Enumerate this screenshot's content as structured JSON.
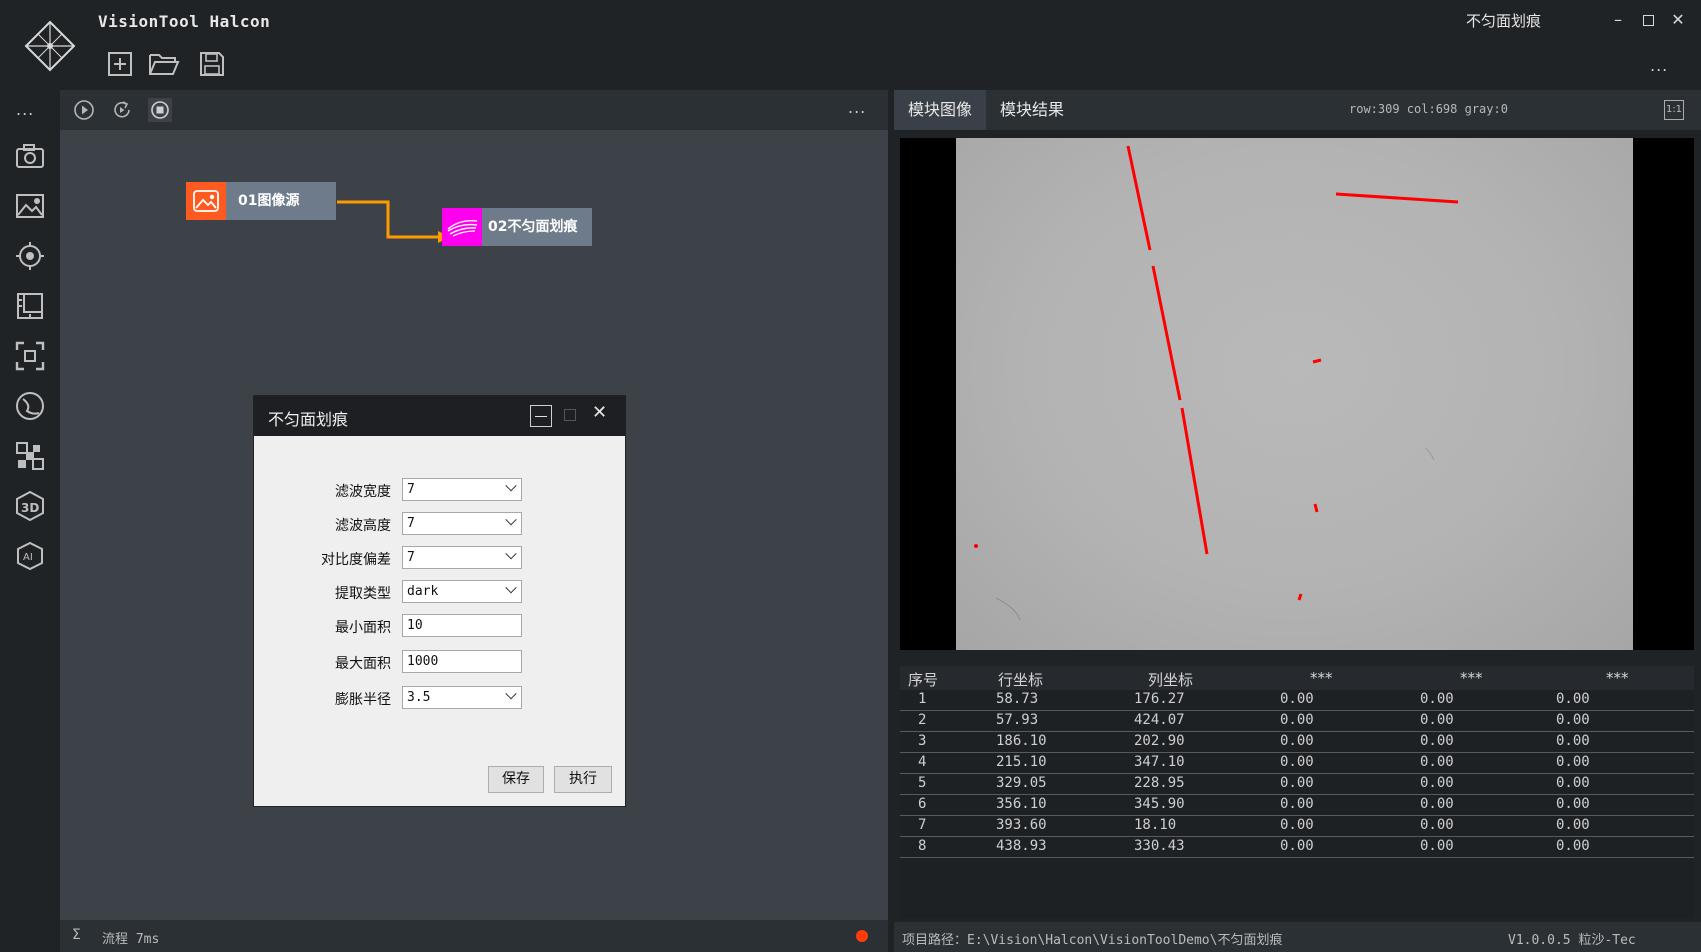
{
  "app": {
    "title": "VisionTool Halcon",
    "window_title": "不匀面划痕",
    "more": "..."
  },
  "toolbar": {
    "new_icon": "new-file-icon",
    "open_icon": "open-folder-icon",
    "save_icon": "save-icon"
  },
  "sidebar": {
    "more": "...",
    "items": [
      {
        "icon": "camera-icon"
      },
      {
        "icon": "image-settings-icon"
      },
      {
        "icon": "target-icon"
      },
      {
        "icon": "measure-icon"
      },
      {
        "icon": "focus-frame-icon"
      },
      {
        "icon": "curve-icon"
      },
      {
        "icon": "pattern-icon"
      },
      {
        "icon": "3d-icon"
      },
      {
        "icon": "ai-icon"
      }
    ]
  },
  "flow": {
    "more": "...",
    "nodes": [
      {
        "label": "01图像源"
      },
      {
        "label": "02不匀面划痕"
      }
    ],
    "status": "流程 7ms",
    "sigma": "Σ"
  },
  "dialog": {
    "title": "不匀面划痕",
    "fields": [
      {
        "label": "滤波宽度",
        "value": "7",
        "type": "select"
      },
      {
        "label": "滤波高度",
        "value": "7",
        "type": "select"
      },
      {
        "label": "对比度偏差",
        "value": "7",
        "type": "select"
      },
      {
        "label": "提取类型",
        "value": "dark",
        "type": "select"
      },
      {
        "label": "最小面积",
        "value": "10",
        "type": "input"
      },
      {
        "label": "最大面积",
        "value": "1000",
        "type": "input"
      },
      {
        "label": "膨胀半径",
        "value": "3.5",
        "type": "select"
      }
    ],
    "save_label": "保存",
    "run_label": "执行"
  },
  "right": {
    "tabs": [
      "模块图像",
      "模块结果"
    ],
    "coord_readout": "row:309 col:698 gray:0",
    "fit_label": "1:1",
    "table": {
      "headers": [
        "序号",
        "行坐标",
        "列坐标",
        "***",
        "***",
        "***"
      ],
      "rows": [
        [
          "1",
          "58.73",
          "176.27",
          "0.00",
          "0.00",
          "0.00"
        ],
        [
          "2",
          "57.93",
          "424.07",
          "0.00",
          "0.00",
          "0.00"
        ],
        [
          "3",
          "186.10",
          "202.90",
          "0.00",
          "0.00",
          "0.00"
        ],
        [
          "4",
          "215.10",
          "347.10",
          "0.00",
          "0.00",
          "0.00"
        ],
        [
          "5",
          "329.05",
          "228.95",
          "0.00",
          "0.00",
          "0.00"
        ],
        [
          "6",
          "356.10",
          "345.90",
          "0.00",
          "0.00",
          "0.00"
        ],
        [
          "7",
          "393.60",
          "18.10",
          "0.00",
          "0.00",
          "0.00"
        ],
        [
          "8",
          "438.93",
          "330.43",
          "0.00",
          "0.00",
          "0.00"
        ]
      ]
    },
    "project_path": "项目路径：E:\\Vision\\Halcon\\VisionToolDemo\\不匀面划痕",
    "version": "V1.0.0.5 粒沙-Tec"
  },
  "colors": {
    "accent_orange": "#ff5a1f",
    "accent_magenta": "#ff00ee",
    "defect_red": "#ff0000"
  }
}
